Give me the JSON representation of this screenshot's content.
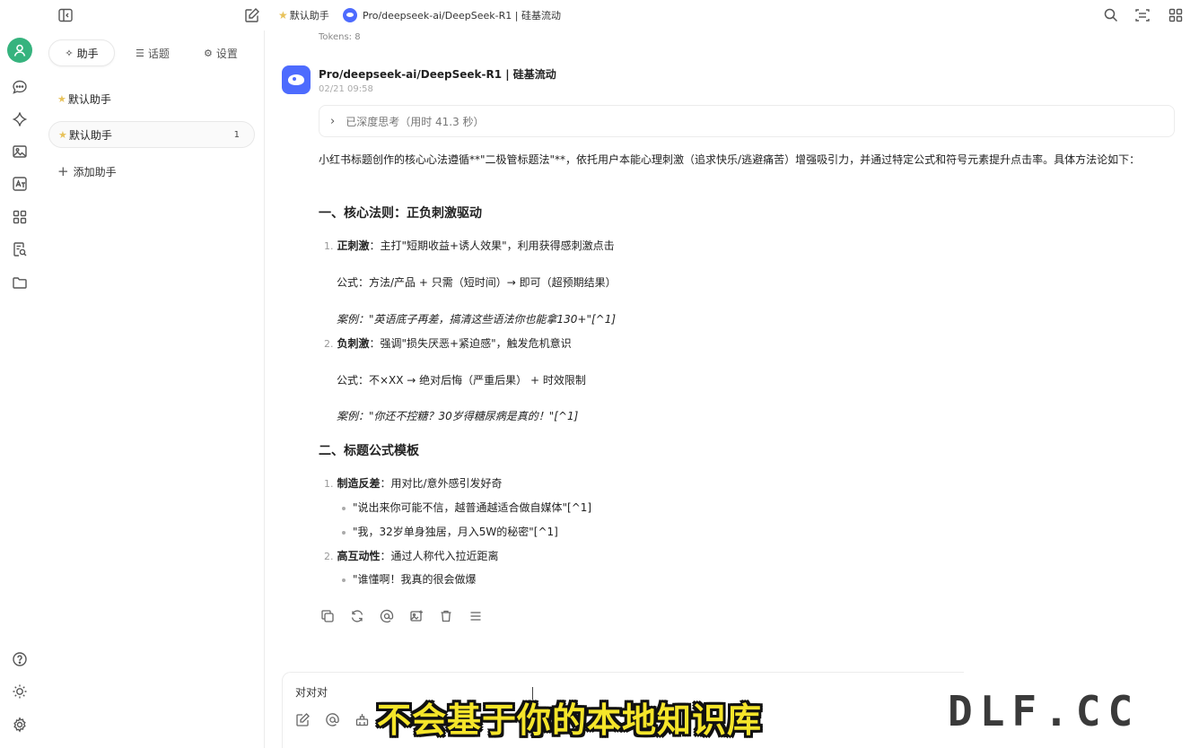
{
  "topbar": {
    "assistant_label": "默认助手",
    "model_label": "Pro/deepseek-ai/DeepSeek-R1 | 硅基流动"
  },
  "sidebar": {
    "tabs": [
      {
        "label": "助手",
        "icon": "sparkle-icon",
        "active": true
      },
      {
        "label": "话题",
        "icon": "list-icon",
        "active": false
      },
      {
        "label": "设置",
        "icon": "gear-icon",
        "active": false
      }
    ],
    "assistants": [
      {
        "label": "默认助手",
        "count": ""
      },
      {
        "label": "默认助手",
        "count": "1"
      }
    ],
    "add_label": "添加助手"
  },
  "chat": {
    "tokens": "Tokens: 8",
    "model_name": "Pro/deepseek-ai/DeepSeek-R1 | 硅基流动",
    "timestamp": "02/21 09:58",
    "thinking": "已深度思考（用时 41.3 秒）",
    "intro": "小红书标题创作的核心心法遵循**\"二极管标题法\"**，依托用户本能心理刺激（追求快乐/逃避痛苦）增强吸引力，并通过特定公式和符号元素提升点击率。具体方法论如下：",
    "section1": {
      "title": "一、核心法则：正负刺激驱动",
      "items": [
        {
          "num": "1.",
          "bold": "正刺激",
          "text": "：主打\"短期收益+诱人效果\"，利用获得感刺激点击",
          "formula": "公式：方法/产品 + 只需（短时间）→ 即可（超预期结果）",
          "example": "案例：\"英语底子再差，搞清这些语法你也能拿130+\"[^1]"
        },
        {
          "num": "2.",
          "bold": "负刺激",
          "text": "：强调\"损失厌恶+紧迫感\"，触发危机意识",
          "formula": "公式：不×XX → 绝对后悔（严重后果） + 时效限制",
          "example": "案例：\"你还不控糖？30岁得糖尿病是真的！\"[^1]"
        }
      ]
    },
    "section2": {
      "title": "二、标题公式模板",
      "items": [
        {
          "num": "1.",
          "bold": "制造反差",
          "text": "：用对比/意外感引发好奇",
          "bullets": [
            "\"说出来你可能不信，越普通越适合做自媒体\"[^1]",
            "\"我，32岁单身独居，月入5W的秘密\"[^1]"
          ]
        },
        {
          "num": "2.",
          "bold": "高互动性",
          "text": "：通过人称代入拉近距离",
          "bullets": [
            "\"谁懂啊！我真的很会做爆"
          ]
        }
      ]
    }
  },
  "input": {
    "value": "对对对"
  },
  "overlay": {
    "subtitle": "不会基于你的本地知识库",
    "watermark": "DLF.CC"
  },
  "colors": {
    "accent": "#4d6bfe",
    "avatar_green": "#36b37e",
    "subtitle_yellow": "#f5e52a"
  }
}
